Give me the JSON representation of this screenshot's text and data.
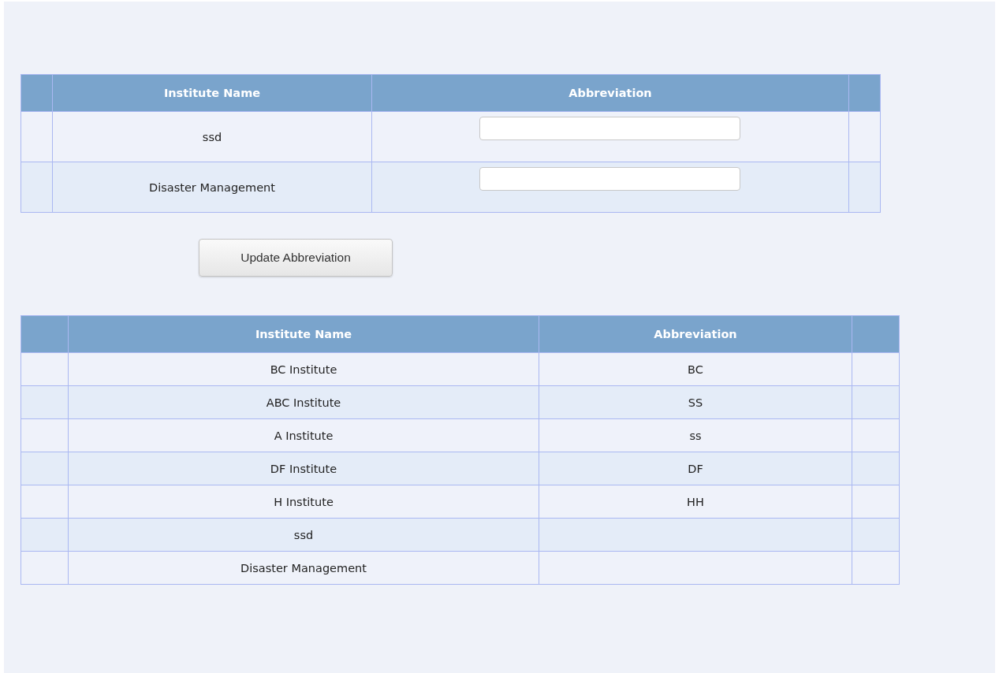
{
  "edit_table": {
    "columns": [
      "Institute Name",
      "Abbreviation"
    ],
    "rows": [
      {
        "name": "ssd",
        "kind": "editable"
      },
      {
        "name": "Disaster Management",
        "kind": "editable"
      }
    ]
  },
  "update_button": "Update Abbreviation",
  "list_table": {
    "columns": [
      "Institute Name",
      "Abbreviation"
    ],
    "rows": [
      {
        "name": "BC Institute",
        "abbreviation": "BC"
      },
      {
        "name": "ABC Institute",
        "abbreviation": "SS"
      },
      {
        "name": "A Institute",
        "abbreviation": "ss"
      },
      {
        "name": "DF Institute",
        "abbreviation": "DF"
      },
      {
        "name": "H Institute",
        "abbreviation": "HH"
      },
      {
        "name": "ssd"
      },
      {
        "name": "Disaster Management"
      }
    ]
  }
}
